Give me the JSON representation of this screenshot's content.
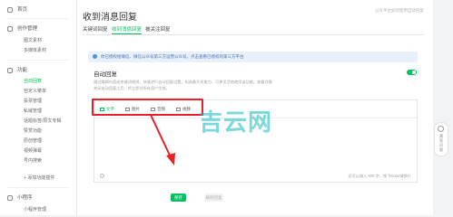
{
  "sidebar": {
    "items": [
      {
        "label": "首页",
        "type": "top"
      },
      {
        "label": "创作管理",
        "type": "section"
      },
      {
        "label": "图文素材",
        "type": "sub"
      },
      {
        "label": "多媒体素材",
        "type": "sub"
      },
      {
        "label": "功能",
        "type": "section"
      },
      {
        "label": "自动回复",
        "type": "sub",
        "active": true
      },
      {
        "label": "自定义菜单",
        "type": "sub"
      },
      {
        "label": "投票管理",
        "type": "sub"
      },
      {
        "label": "私域管理",
        "type": "sub"
      },
      {
        "label": "话题标签/原文专辑",
        "type": "sub"
      },
      {
        "label": "赞赏功能",
        "type": "sub"
      },
      {
        "label": "原创管理",
        "type": "sub"
      },
      {
        "label": "视频弹幕",
        "type": "sub"
      },
      {
        "label": "号内搜索",
        "type": "sub"
      },
      {
        "label": "+ 添加功能插件",
        "type": "sub"
      },
      {
        "label": "小程序",
        "type": "section"
      },
      {
        "label": "小程序管理",
        "type": "sub"
      }
    ]
  },
  "header": {
    "title": "收到消息回复",
    "top_right": "公众平台如何使用自动回复"
  },
  "tabs": [
    {
      "label": "关键词回复",
      "active": false
    },
    {
      "label": "收到消息回复",
      "active": true
    },
    {
      "label": "被关注回复",
      "active": false
    }
  ],
  "notice": {
    "text": "你已授权给微信、微信公众号第三方运营公众号，点击查看已授权的第三方平台"
  },
  "card": {
    "title": "自动回复",
    "toggle_on": true,
    "desc_lines": [
      "通过编辑内容或关键词规则，快速进行自动回复设置。如具备开发能力，可更灵活地使用该功能。查看详情",
      "关闭自动回复之后，将立即对所有用户生效。"
    ]
  },
  "editor": {
    "tools": [
      {
        "label": "文字",
        "icon": "text-icon",
        "active": true
      },
      {
        "label": "图片",
        "icon": "image-icon",
        "active": false
      },
      {
        "label": "音频",
        "icon": "audio-icon",
        "active": false
      },
      {
        "label": "视频",
        "icon": "video-icon",
        "active": false
      }
    ],
    "counter": "还可以输入 600 字，按下Enter键换行"
  },
  "buttons": {
    "save": "保存",
    "delete": "删除回复"
  },
  "float_help": {
    "label": "遇到问题"
  },
  "watermark": "吉云网",
  "colors": {
    "accent": "#07c160",
    "highlight": "#e8202a",
    "watermark": "#0fb9be"
  }
}
